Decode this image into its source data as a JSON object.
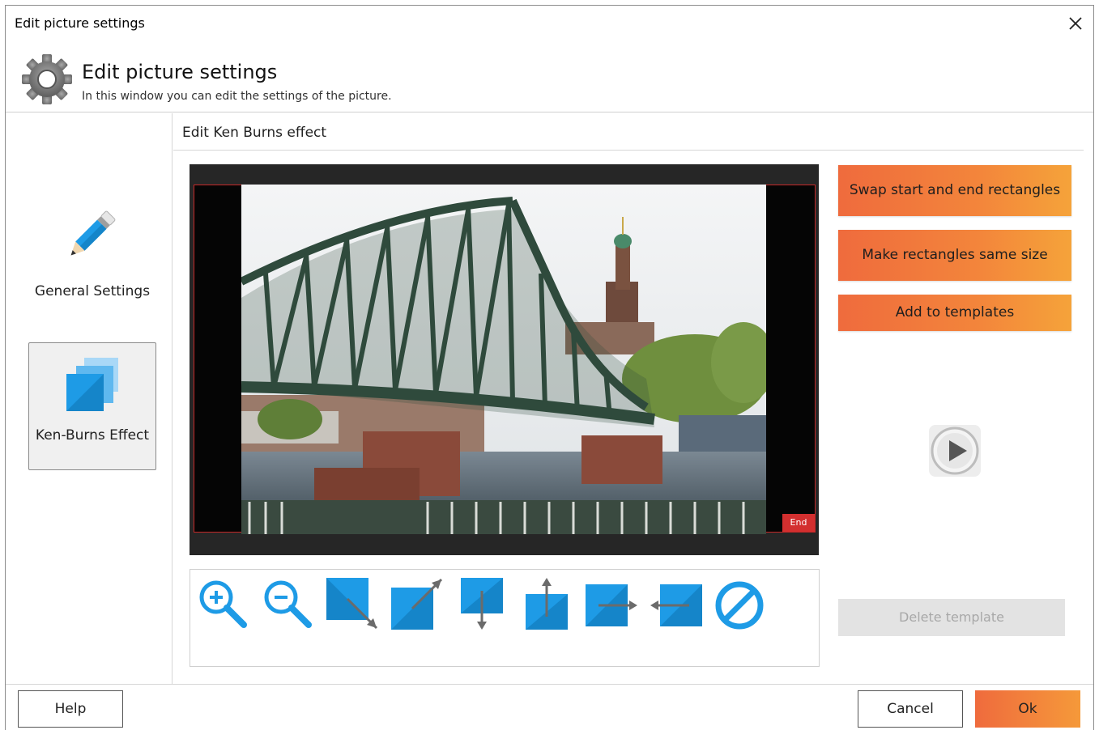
{
  "window": {
    "title": "Edit picture settings"
  },
  "header": {
    "title": "Edit picture settings",
    "subtitle": "In this window you can edit the settings of the picture."
  },
  "sidebar": {
    "items": [
      {
        "label": "General Settings",
        "icon": "pencil-icon",
        "selected": false
      },
      {
        "label": "Ken-Burns Effect",
        "icon": "ken-burns-icon",
        "selected": true
      }
    ]
  },
  "main": {
    "section_title": "Edit Ken Burns effect",
    "preview": {
      "end_label": "End",
      "frame_color": "#c62828"
    },
    "tools": [
      {
        "name": "zoom-in-icon"
      },
      {
        "name": "zoom-out-icon"
      },
      {
        "name": "move-bottom-right-icon"
      },
      {
        "name": "move-top-right-icon"
      },
      {
        "name": "move-down-icon"
      },
      {
        "name": "move-up-icon"
      },
      {
        "name": "move-right-icon"
      },
      {
        "name": "move-left-icon"
      },
      {
        "name": "no-effect-icon"
      }
    ]
  },
  "actions": {
    "swap_label": "Swap start and end rectangles",
    "same_size_label": "Make rectangles same size",
    "add_template_label": "Add to templates",
    "delete_template_label": "Delete template",
    "play_icon": "play-icon"
  },
  "footer": {
    "help_label": "Help",
    "cancel_label": "Cancel",
    "ok_label": "Ok"
  },
  "colors": {
    "accent_start": "#ef6b3d",
    "accent_end": "#f5a33a",
    "icon_blue": "#1e9be6"
  }
}
